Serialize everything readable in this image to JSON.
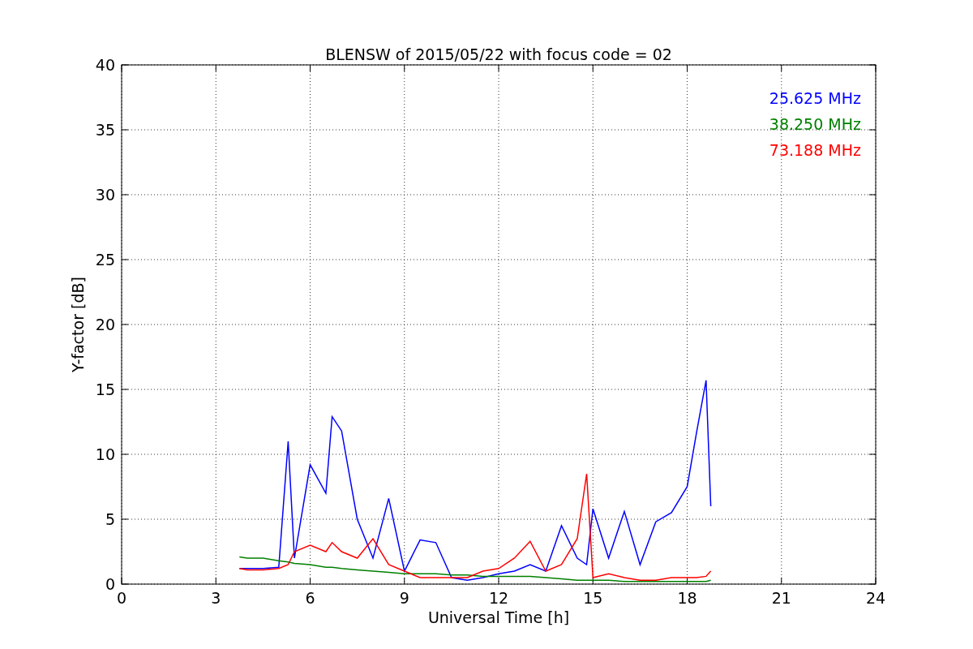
{
  "figure": {
    "chart_data": {
      "type": "line",
      "title": "BLENSW of 2015/05/22 with focus code = 02",
      "xlabel": "Universal Time [h]",
      "ylabel": "Y-factor [dB]",
      "x": [
        3.75,
        4,
        4.5,
        5,
        5.3,
        5.5,
        6,
        6.5,
        6.7,
        7,
        7.5,
        8,
        8.5,
        9,
        9.5,
        10,
        10.5,
        11,
        11.5,
        12,
        12.5,
        13,
        13.5,
        14,
        14.5,
        14.8,
        15,
        15.5,
        16,
        16.5,
        17,
        17.5,
        18,
        18.3,
        18.6,
        18.75
      ],
      "series": [
        {
          "name": "25.625 MHz",
          "color": "#0000ff",
          "values": [
            1.2,
            1.2,
            1.2,
            1.3,
            11,
            2,
            9.2,
            7,
            12.9,
            11.8,
            5,
            2,
            6.6,
            1,
            3.4,
            3.2,
            0.5,
            0.3,
            0.5,
            0.8,
            1,
            1.5,
            1,
            4.5,
            2,
            1.5,
            5.8,
            2,
            5.6,
            1.5,
            4.8,
            5.5,
            7.5,
            11.7,
            15.7,
            6
          ]
        },
        {
          "name": "38.250 MHz",
          "color": "#008000",
          "values": [
            2.1,
            2,
            2,
            1.8,
            1.7,
            1.6,
            1.5,
            1.3,
            1.3,
            1.2,
            1.1,
            1,
            0.9,
            0.8,
            0.8,
            0.8,
            0.7,
            0.7,
            0.6,
            0.6,
            0.6,
            0.6,
            0.5,
            0.4,
            0.3,
            0.3,
            0.3,
            0.3,
            0.2,
            0.2,
            0.2,
            0.2,
            0.2,
            0.2,
            0.2,
            0.3
          ]
        },
        {
          "name": "73.188 MHz",
          "color": "#ff0000",
          "values": [
            1.2,
            1.1,
            1.1,
            1.2,
            1.5,
            2.5,
            3,
            2.5,
            3.2,
            2.5,
            2,
            3.5,
            1.5,
            1,
            0.5,
            0.5,
            0.5,
            0.5,
            1,
            1.2,
            2,
            3.3,
            1,
            1.5,
            3.5,
            8.5,
            0.5,
            0.8,
            0.5,
            0.3,
            0.3,
            0.5,
            0.5,
            0.5,
            0.6,
            1
          ]
        }
      ],
      "grid": true,
      "xlim": [
        0,
        24
      ],
      "ylim": [
        0,
        40
      ],
      "xticks": [
        0,
        3,
        6,
        9,
        12,
        15,
        18,
        21,
        24
      ],
      "yticks": [
        0,
        5,
        10,
        15,
        20,
        25,
        30,
        35,
        40
      ]
    }
  }
}
